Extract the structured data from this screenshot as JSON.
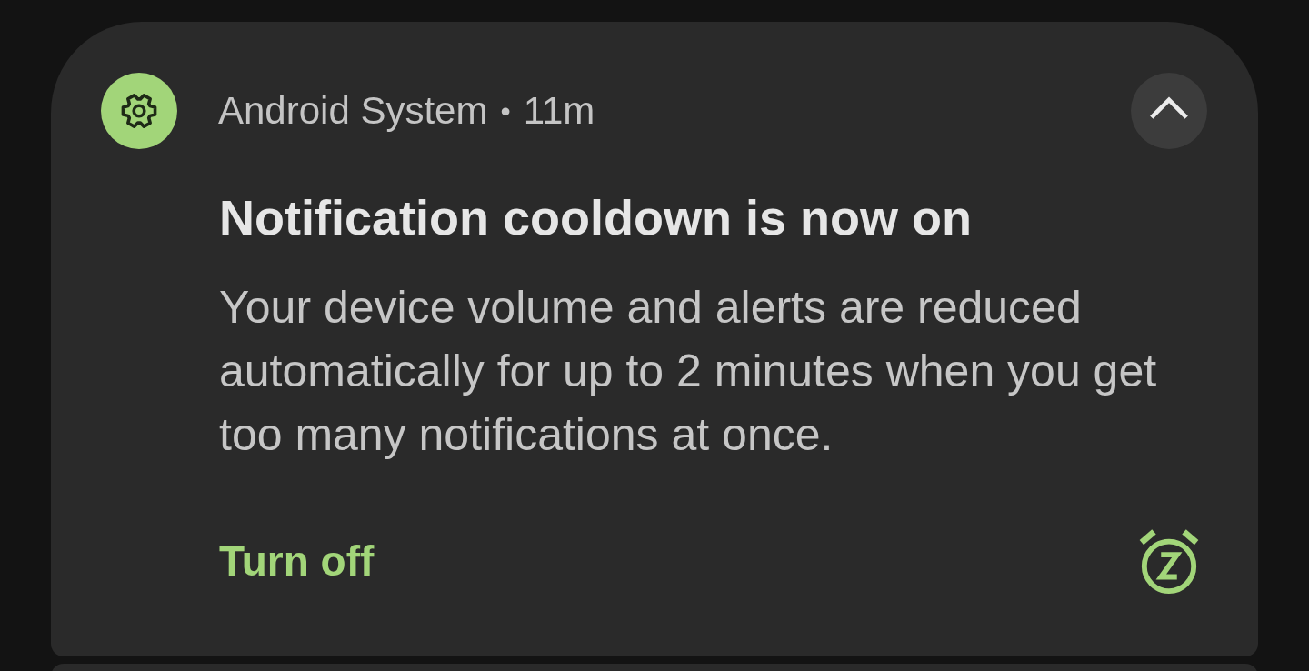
{
  "notification": {
    "app_name": "Android System",
    "separator": "•",
    "time": "11m",
    "expanded": true,
    "title": "Notification cooldown is now on",
    "body": "Your device volume and alerts are reduced automatically for up to 2 minutes when you get too many notifications at once.",
    "actions": [
      {
        "label": "Turn off"
      }
    ]
  }
}
